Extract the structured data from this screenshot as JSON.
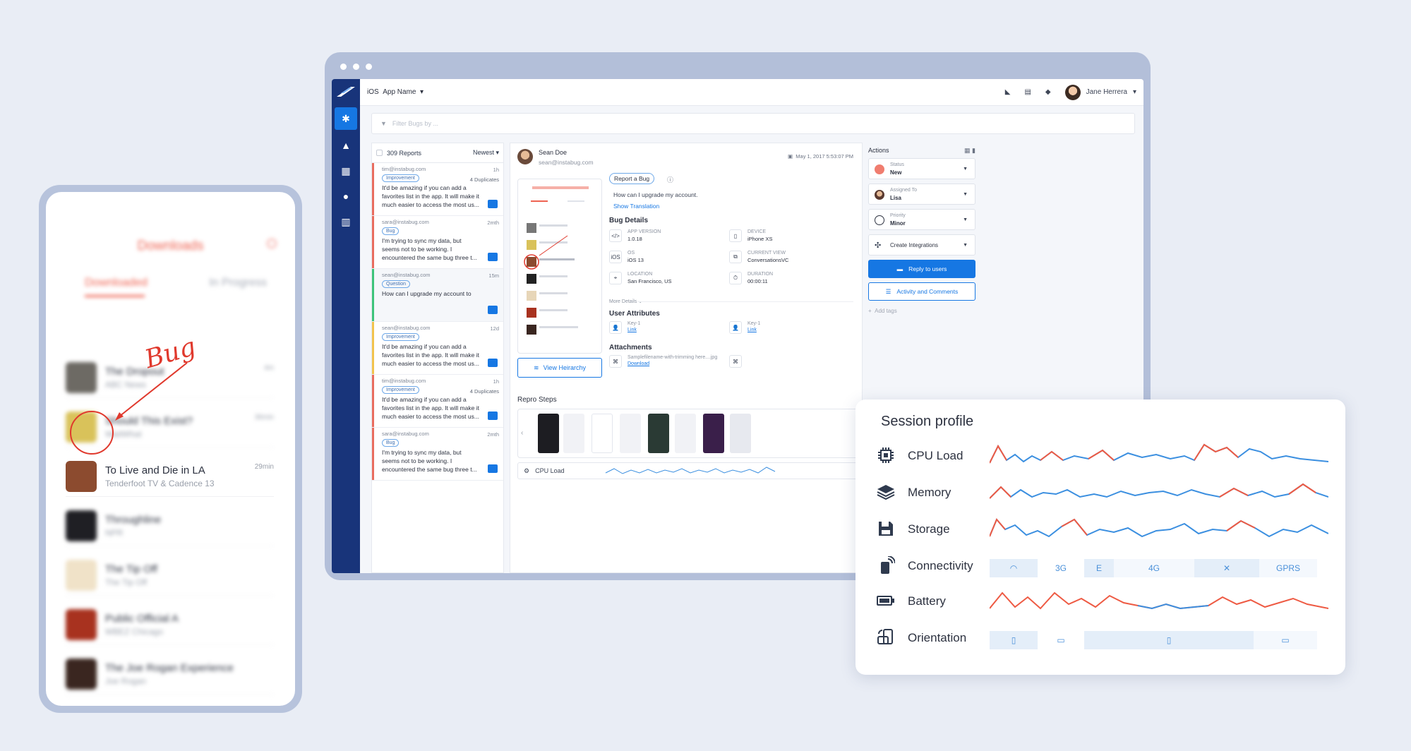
{
  "phone": {
    "title": "Downloads",
    "tabs": [
      "Downloaded",
      "In Progress"
    ],
    "items": [
      {
        "title": "The Dropout",
        "sub": "ABC News",
        "time": "4m",
        "color": "#6d6a64"
      },
      {
        "title": "Should This Exist?",
        "sub": "WaitWhat",
        "time": "36min",
        "color": "#d9c25a"
      },
      {
        "title": "To Live and Die in LA",
        "sub": "Tenderfoot TV & Cadence 13",
        "time": "29min",
        "color": "#8c4b2f"
      },
      {
        "title": "Throughline",
        "sub": "NPR",
        "time": "",
        "color": "#1f1f24"
      },
      {
        "title": "The Tip Off",
        "sub": "The Tip Off",
        "time": "",
        "color": "#f0e2c8"
      },
      {
        "title": "Public Official A",
        "sub": "WBEZ Chicago",
        "time": "",
        "color": "#a8321f"
      },
      {
        "title": "The Joe Rogan Experience",
        "sub": "Joe Rogan",
        "time": "",
        "color": "#3a2620"
      }
    ],
    "annotation": "Bug"
  },
  "app": {
    "platform": "iOS",
    "app_name": "App Name",
    "user_name": "Jane Herrera",
    "filter_placeholder": "Filter Bugs by ...",
    "reports_count": "309 Reports",
    "sort": "Newest",
    "reports": [
      {
        "email": "tim@instabug.com",
        "time": "1h",
        "tag": "Improvement",
        "dup": "4 Duplicates",
        "msg": "It'd be amazing if you can add a favorites list in the app. It will make it much easier to access the most us...",
        "stripe": "#e96d5f"
      },
      {
        "email": "sara@instabug.com",
        "time": "2mth",
        "tag": "Bug",
        "dup": "",
        "msg": "I'm trying to sync my data, but seems not to be working. I encountered the same bug three t...",
        "stripe": "#e96d5f"
      },
      {
        "email": "sean@instabug.com",
        "time": "15m",
        "tag": "Question",
        "dup": "",
        "msg": "How can I upgrade my account to",
        "stripe": "#3ec47a"
      },
      {
        "email": "sean@instabug.com",
        "time": "12d",
        "tag": "Improvement",
        "dup": "",
        "msg": "It'd be amazing if you can add a favorites list in the app. It will make it much easier to access the most us...",
        "stripe": "#f2c34d"
      },
      {
        "email": "tim@instabug.com",
        "time": "1h",
        "tag": "Improvement",
        "dup": "4 Duplicates",
        "msg": "It'd be amazing if you can add a favorites list in the app. It will make it much easier to access the most us...",
        "stripe": "#e96d5f"
      },
      {
        "email": "sara@instabug.com",
        "time": "2mth",
        "tag": "Bug",
        "dup": "",
        "msg": "I'm trying to sync my data, but seems not to be working. I encountered the same bug three t...",
        "stripe": "#e96d5f"
      }
    ],
    "detail": {
      "name": "Sean Doe",
      "email": "sean@instabug.com",
      "date": "May 1, 2017 5:53:07 PM",
      "report_type": "Report a Bug",
      "question": "How can I upgrade my account.",
      "show_translation": "Show Translation",
      "bug_details_title": "Bug Details",
      "fields": [
        {
          "key": "APP VERSION",
          "value": "1.0.18",
          "icon": "</>"
        },
        {
          "key": "DEVICE",
          "value": "iPhone XS",
          "icon": "▯"
        },
        {
          "key": "OS",
          "value": "iOS 13",
          "icon": "iOS"
        },
        {
          "key": "CURRENT VIEW",
          "value": "ConversationsVC",
          "icon": "⧉"
        },
        {
          "key": "LOCATION",
          "value": "San Francisco, US",
          "icon": "⌖"
        },
        {
          "key": "DURATION",
          "value": "00:00:11",
          "icon": "⏱"
        }
      ],
      "more_details": "More Details",
      "user_attributes_title": "User Attributes",
      "attributes": [
        {
          "key": "Key-1",
          "link": "Link"
        },
        {
          "key": "Key-1",
          "link": "Link"
        }
      ],
      "attachments_title": "Attachments",
      "attachment_name": "Samplefilename-with-trimming here....jpg",
      "attachment_link": "Download",
      "view_hierarchy": "View Heirarchy",
      "repro_title": "Repro Steps",
      "cpu_strip": "CPU Load"
    },
    "actions": {
      "title": "Actions",
      "status_label": "Status",
      "status_value": "New",
      "assigned_label": "Assigned To",
      "assigned_value": "Lisa",
      "priority_label": "Priority",
      "priority_value": "Minor",
      "integrations": "Create Integrations",
      "reply": "Reply to users",
      "activity": "Activity and Comments",
      "add_tags": "Add tags"
    }
  },
  "session_profile": {
    "title": "Session profile",
    "rows": [
      {
        "label": "CPU Load",
        "icon": "cpu-icon"
      },
      {
        "label": "Memory",
        "icon": "layers-icon"
      },
      {
        "label": "Storage",
        "icon": "save-icon"
      },
      {
        "label": "Connectivity",
        "icon": "phone-signal-icon"
      },
      {
        "label": "Battery",
        "icon": "battery-icon"
      },
      {
        "label": "Orientation",
        "icon": "rotate-device-icon"
      }
    ],
    "connectivity_segments": [
      "",
      "3G",
      "E",
      "4G",
      "✕",
      "GPRS"
    ],
    "colors": {
      "red": "#ee5a43",
      "blue": "#3b8fe0"
    }
  }
}
